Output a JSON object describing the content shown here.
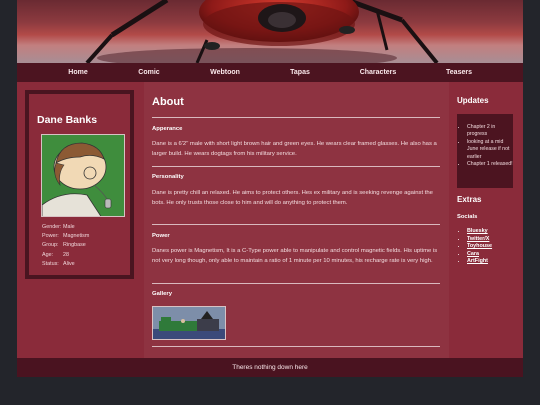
{
  "nav": {
    "items": [
      "Home",
      "Comic",
      "Webtoon",
      "Tapas",
      "Characters",
      "Teasers"
    ]
  },
  "profile": {
    "name": "Dane Banks",
    "stats": [
      {
        "key": "Gender:",
        "value": "Male"
      },
      {
        "key": "Power:",
        "value": "Magnetism"
      },
      {
        "key": "Group:",
        "value": "Ringbase"
      },
      {
        "key": "Age:",
        "value": "28"
      },
      {
        "key": "Status:",
        "value": "Alive"
      }
    ]
  },
  "main": {
    "title": "About",
    "sections": [
      {
        "heading": "Apperance",
        "text": "Dane is a 6'2\" male with short light brown hair and green eyes. He wears clear framed glasses. He also has a larger build. He wears dogtags from his military service."
      },
      {
        "heading": "Personality",
        "text": "Dane is pretty chill an relaxed. He aims to protect others. Hes ex military and is seeking revenge against the bots. He only trusts those close to him and will do anything to protect them."
      },
      {
        "heading": "Power",
        "text": "Danes power is Magnetism, It is a C-Type power able to manipulate and control magnetic fields. His uptime is not very long though, only able to maintain a ratio of 1 minute per 10 minutes, his recharge rate is very high."
      },
      {
        "heading": "Gallery",
        "text": ""
      }
    ]
  },
  "sidebar": {
    "updates_title": "Updates",
    "updates": [
      "Chapter 2 in progress",
      "looking at a mid June release if not earlier",
      "Chapter 1 released!"
    ],
    "extras_title": "Extras",
    "socials_label": "Socials",
    "socials": [
      "Bluesky",
      "Twitter/X",
      "Toyhouse",
      "Cara",
      "ArtFight"
    ]
  },
  "footer": {
    "text": "Theres nothing down here"
  },
  "colors": {
    "page_bg": "#23252b",
    "panel": "#8a2b3a",
    "dark_panel": "#4c1420"
  }
}
